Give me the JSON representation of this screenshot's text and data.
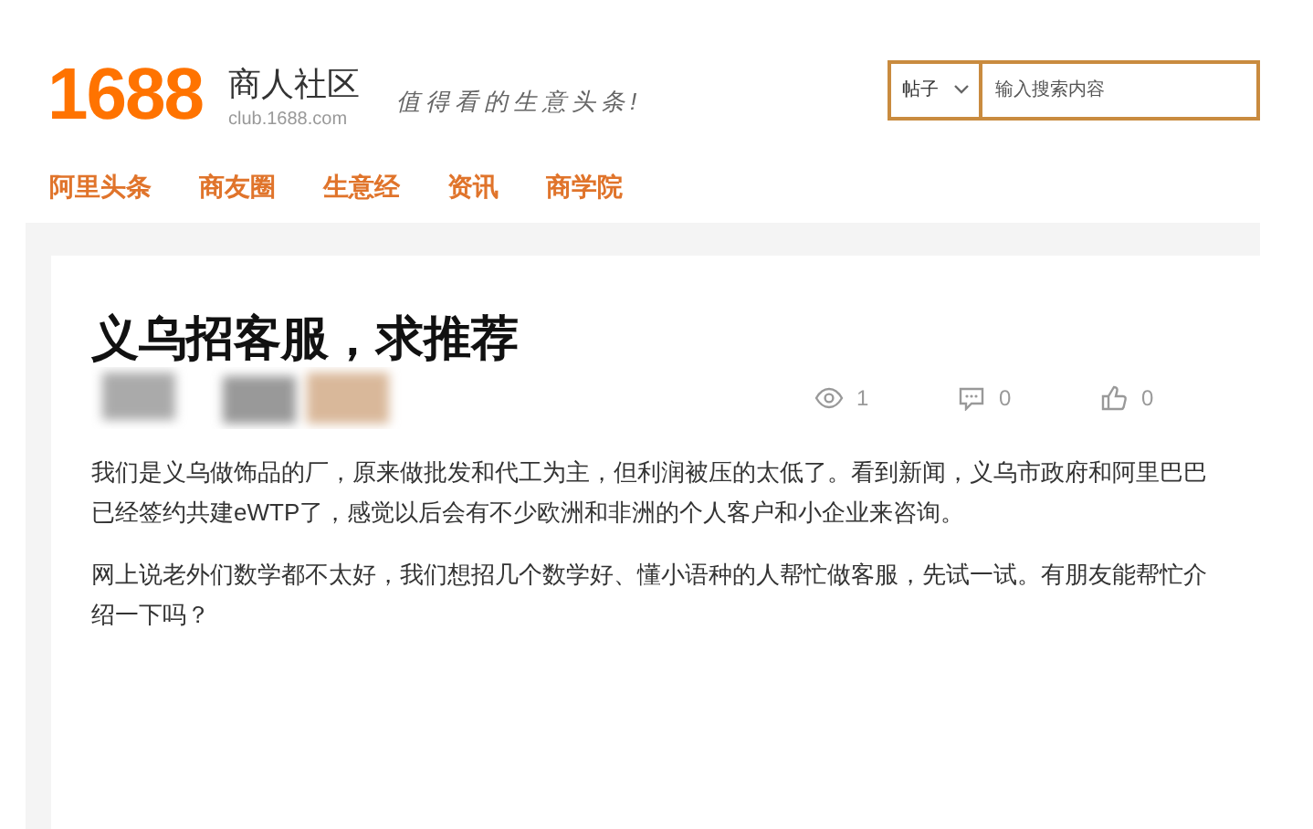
{
  "logo": {
    "number": "1688",
    "title": "商人社区",
    "domain": "club.1688.com",
    "slogan": "值得看的生意头条!"
  },
  "search": {
    "category": "帖子",
    "placeholder": "输入搜索内容"
  },
  "nav": [
    {
      "label": "阿里头条"
    },
    {
      "label": "商友圈"
    },
    {
      "label": "生意经"
    },
    {
      "label": "资讯"
    },
    {
      "label": "商学院"
    }
  ],
  "post": {
    "title": "义乌招客服，求推荐",
    "stats": [
      {
        "kind": "views",
        "count": "1"
      },
      {
        "kind": "comments",
        "count": "0"
      },
      {
        "kind": "likes",
        "count": "0"
      }
    ],
    "paragraphs": [
      "我们是义乌做饰品的厂，原来做批发和代工为主，但利润被压的太低了。看到新闻，义乌市政府和阿里巴巴已经签约共建eWTP了，感觉以后会有不少欧洲和非洲的个人客户和小企业来咨询。",
      "网上说老外们数学都不太好，我们想招几个数学好、懂小语种的人帮忙做客服，先试一试。有朋友能帮忙介绍一下吗？"
    ]
  }
}
